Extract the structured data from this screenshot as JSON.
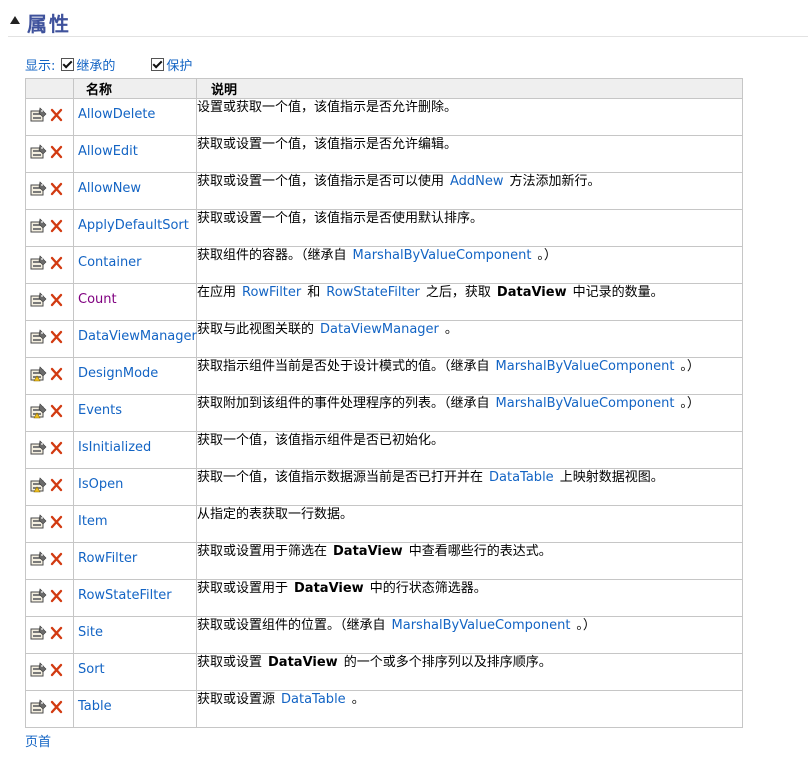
{
  "section": {
    "title": "属性"
  },
  "filter": {
    "label": "显示:",
    "inherited_label": "继承的",
    "protected_label": "保护"
  },
  "table": {
    "headers": {
      "icons": "",
      "name": "名称",
      "description": "说明"
    },
    "rows": [
      {
        "name": "AllowDelete",
        "icon": "property-icon",
        "desc": [
          {
            "t": "设置或获取一个值，该值指示是否允许删除。"
          }
        ]
      },
      {
        "name": "AllowEdit",
        "icon": "property-icon",
        "desc": [
          {
            "t": "获取或设置一个值，该值指示是否允许编辑。"
          }
        ]
      },
      {
        "name": "AllowNew",
        "icon": "property-icon",
        "desc": [
          {
            "t": "获取或设置一个值，该值指示是否可以使用"
          },
          {
            "l": "AddNew"
          },
          {
            "t": "方法添加新行。"
          }
        ]
      },
      {
        "name": "ApplyDefaultSort",
        "icon": "property-icon",
        "desc": [
          {
            "t": "获取或设置一个值，该值指示是否使用默认排序。"
          }
        ]
      },
      {
        "name": "Container",
        "icon": "property-icon",
        "desc": [
          {
            "t": "获取组件的容器。（继承自"
          },
          {
            "l": "MarshalByValueComponent"
          },
          {
            "t": "。）"
          }
        ]
      },
      {
        "name": "Count",
        "icon": "property-icon",
        "visited": true,
        "desc": [
          {
            "t": "在应用"
          },
          {
            "l": "RowFilter"
          },
          {
            "t": "和"
          },
          {
            "l": "RowStateFilter"
          },
          {
            "t": "之后，获取"
          },
          {
            "b": "DataView"
          },
          {
            "t": "中记录的数量。"
          }
        ]
      },
      {
        "name": "DataViewManager",
        "icon": "property-icon",
        "desc": [
          {
            "t": "获取与此视图关联的"
          },
          {
            "l": "DataViewManager"
          },
          {
            "t": "。"
          }
        ]
      },
      {
        "name": "DesignMode",
        "icon": "protected-property-icon",
        "desc": [
          {
            "t": "获取指示组件当前是否处于设计模式的值。（继承自"
          },
          {
            "l": "MarshalByValueComponent"
          },
          {
            "t": "。）"
          }
        ]
      },
      {
        "name": "Events",
        "icon": "protected-property-icon",
        "desc": [
          {
            "t": "获取附加到该组件的事件处理程序的列表。（继承自"
          },
          {
            "l": "MarshalByValueComponent"
          },
          {
            "t": "。）"
          }
        ]
      },
      {
        "name": "IsInitialized",
        "icon": "property-icon",
        "desc": [
          {
            "t": "获取一个值，该值指示组件是否已初始化。"
          }
        ]
      },
      {
        "name": "IsOpen",
        "icon": "protected-property-icon",
        "desc": [
          {
            "t": "获取一个值，该值指示数据源当前是否已打开并在"
          },
          {
            "l": "DataTable"
          },
          {
            "t": "上映射数据视图。"
          }
        ]
      },
      {
        "name": "Item",
        "icon": "property-icon",
        "desc": [
          {
            "t": "从指定的表获取一行数据。"
          }
        ]
      },
      {
        "name": "RowFilter",
        "icon": "property-icon",
        "desc": [
          {
            "t": "获取或设置用于筛选在"
          },
          {
            "b": "DataView"
          },
          {
            "t": "中查看哪些行的表达式。"
          }
        ]
      },
      {
        "name": "RowStateFilter",
        "icon": "property-icon",
        "desc": [
          {
            "t": "获取或设置用于"
          },
          {
            "b": "DataView"
          },
          {
            "t": "中的行状态筛选器。"
          }
        ]
      },
      {
        "name": "Site",
        "icon": "property-icon",
        "desc": [
          {
            "t": "获取或设置组件的位置。（继承自"
          },
          {
            "l": "MarshalByValueComponent"
          },
          {
            "t": "。）"
          }
        ]
      },
      {
        "name": "Sort",
        "icon": "property-icon",
        "desc": [
          {
            "t": "获取或设置"
          },
          {
            "b": "DataView"
          },
          {
            "t": "的一个或多个排序列以及排序顺序。"
          }
        ]
      },
      {
        "name": "Table",
        "icon": "property-icon",
        "desc": [
          {
            "t": "获取或设置源"
          },
          {
            "l": "DataTable"
          },
          {
            "t": "。"
          }
        ]
      }
    ]
  },
  "footer": {
    "link": "页首"
  },
  "colors": {
    "link": "#1364c4",
    "visited_link": "#800080",
    "title": "#3f529c"
  }
}
